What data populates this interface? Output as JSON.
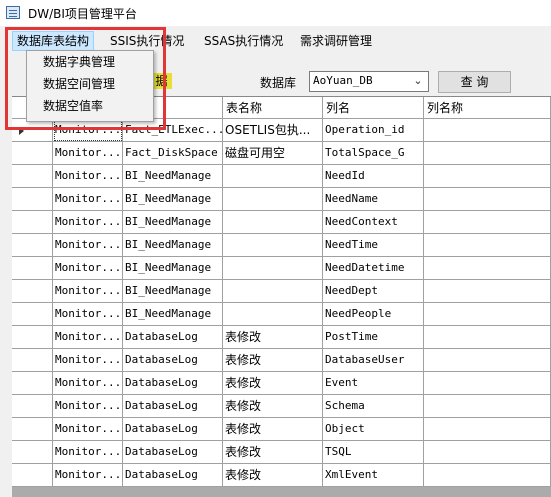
{
  "window": {
    "title": "DW/BI项目管理平台"
  },
  "menu": {
    "items": [
      {
        "label": "数据库表结构"
      },
      {
        "label": "SSIS执行情况"
      },
      {
        "label": "SSAS执行情况"
      },
      {
        "label": "需求调研管理"
      }
    ],
    "dropdown": [
      {
        "label": "数据字典管理"
      },
      {
        "label": "数据空间管理"
      },
      {
        "label": "数据空值率"
      }
    ]
  },
  "toolbar": {
    "partial_label": "据",
    "db_label": "数据库",
    "db_value": "AoYuan_DB",
    "query_label": "查 询"
  },
  "grid": {
    "headers": [
      "",
      "",
      "表名称",
      "列名",
      "列名称"
    ],
    "rows": [
      [
        "Monitor...",
        "Fact_ETLExec...",
        "OSETLIS包执...",
        "Operation_id",
        ""
      ],
      [
        "Monitor...",
        "Fact_DiskSpace",
        "磁盘可用空",
        "TotalSpace_G",
        ""
      ],
      [
        "Monitor...",
        "BI_NeedManage",
        "",
        "NeedId",
        ""
      ],
      [
        "Monitor...",
        "BI_NeedManage",
        "",
        "NeedName",
        ""
      ],
      [
        "Monitor...",
        "BI_NeedManage",
        "",
        "NeedContext",
        ""
      ],
      [
        "Monitor...",
        "BI_NeedManage",
        "",
        "NeedTime",
        ""
      ],
      [
        "Monitor...",
        "BI_NeedManage",
        "",
        "NeedDatetime",
        ""
      ],
      [
        "Monitor...",
        "BI_NeedManage",
        "",
        "NeedDept",
        ""
      ],
      [
        "Monitor...",
        "BI_NeedManage",
        "",
        "NeedPeople",
        ""
      ],
      [
        "Monitor...",
        "DatabaseLog",
        "表修改",
        "PostTime",
        ""
      ],
      [
        "Monitor...",
        "DatabaseLog",
        "表修改",
        "DatabaseUser",
        ""
      ],
      [
        "Monitor...",
        "DatabaseLog",
        "表修改",
        "Event",
        ""
      ],
      [
        "Monitor...",
        "DatabaseLog",
        "表修改",
        "Schema",
        ""
      ],
      [
        "Monitor...",
        "DatabaseLog",
        "表修改",
        "Object",
        ""
      ],
      [
        "Monitor...",
        "DatabaseLog",
        "表修改",
        "TSQL",
        ""
      ],
      [
        "Monitor...",
        "DatabaseLog",
        "表修改",
        "XmlEvent",
        ""
      ]
    ]
  }
}
